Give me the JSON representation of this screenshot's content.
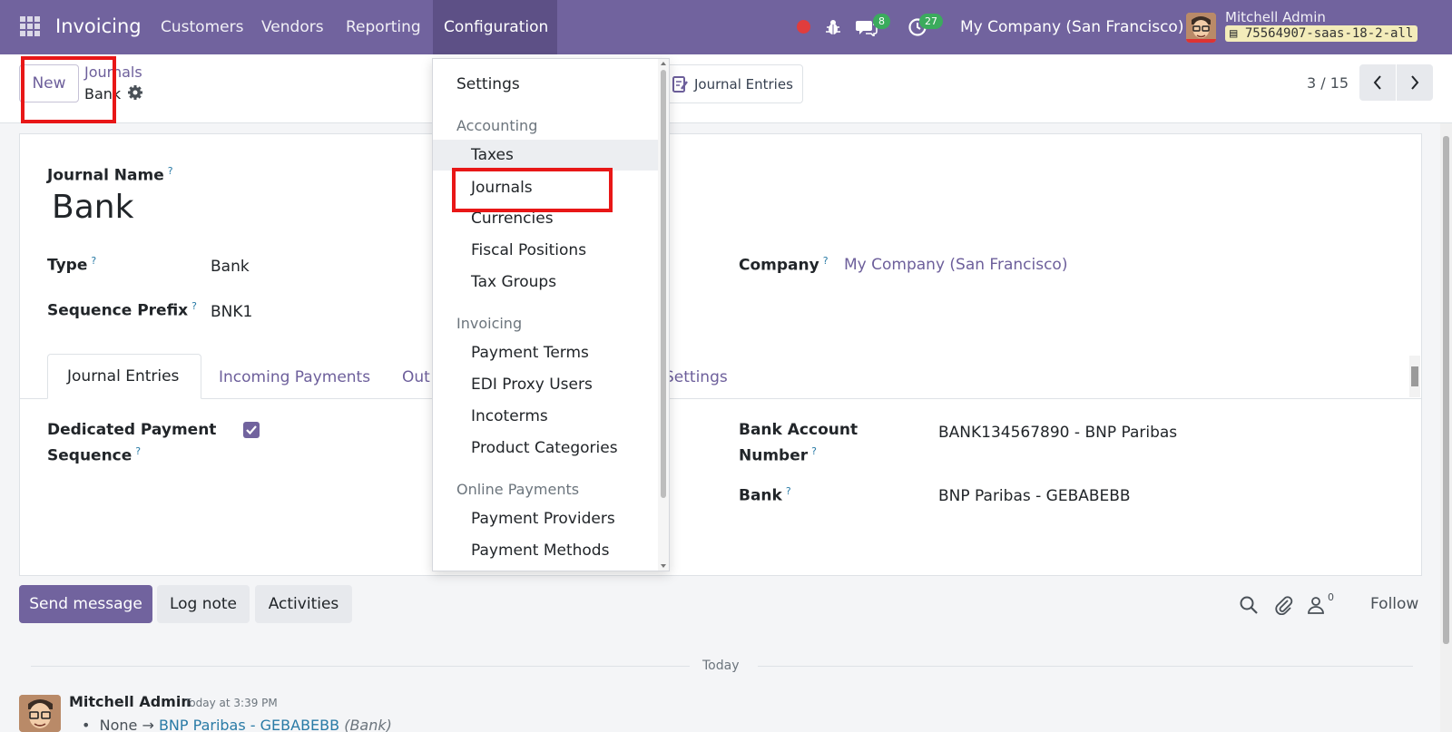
{
  "navbar": {
    "app_name": "Invoicing",
    "menu": [
      "Customers",
      "Vendors",
      "Reporting",
      "Configuration"
    ],
    "chat_count": "8",
    "activity_count": "27",
    "company": "My Company (San Francisco)",
    "user_name": "Mitchell Admin",
    "database": "75564907-saas-18-2-all",
    "brand_color": "#71639e"
  },
  "control_panel": {
    "new_label": "New",
    "breadcrumb_parent": "Journals",
    "breadcrumb_current": "Bank",
    "journal_entries_button": "Journal Entries",
    "pager": "3 / 15"
  },
  "dropdown": {
    "settings": "Settings",
    "sections": [
      {
        "header": "Accounting",
        "items": [
          "Taxes",
          "Journals",
          "Currencies",
          "Fiscal Positions",
          "Tax Groups"
        ]
      },
      {
        "header": "Invoicing",
        "items": [
          "Payment Terms",
          "EDI Proxy Users",
          "Incoterms",
          "Product Categories"
        ]
      },
      {
        "header": "Online Payments",
        "items": [
          "Payment Providers",
          "Payment Methods"
        ]
      }
    ],
    "highlighted_item": "Journals"
  },
  "form": {
    "journal_name_label": "Journal Name",
    "journal_name": "Bank",
    "type_label": "Type",
    "type_value": "Bank",
    "sequence_prefix_label": "Sequence Prefix",
    "sequence_prefix_value": "BNK1",
    "company_label": "Company",
    "company_value": "My Company (San Francisco)",
    "help_mark": "?",
    "tabs": [
      "Journal Entries",
      "Incoming Payments",
      "Out",
      "Settings"
    ],
    "dedicated_payment_label_1": "Dedicated Payment",
    "dedicated_payment_label_2": "Sequence",
    "dedicated_payment_checked": true,
    "bank_account_label_1": "Bank Account",
    "bank_account_label_2": "Number",
    "bank_account_value": "BANK134567890 - BNP Paribas",
    "bank_label": "Bank",
    "bank_value": "BNP Paribas - GEBABEBB"
  },
  "chatter": {
    "send_message": "Send message",
    "log_note": "Log note",
    "activities": "Activities",
    "followers_count": "0",
    "follow": "Follow",
    "today": "Today",
    "message": {
      "author": "Mitchell Admin",
      "time": "Today at 3:39 PM",
      "old_value": "None",
      "arrow": "→",
      "new_value": "BNP Paribas - GEBABEBB",
      "field": "(Bank)"
    }
  }
}
